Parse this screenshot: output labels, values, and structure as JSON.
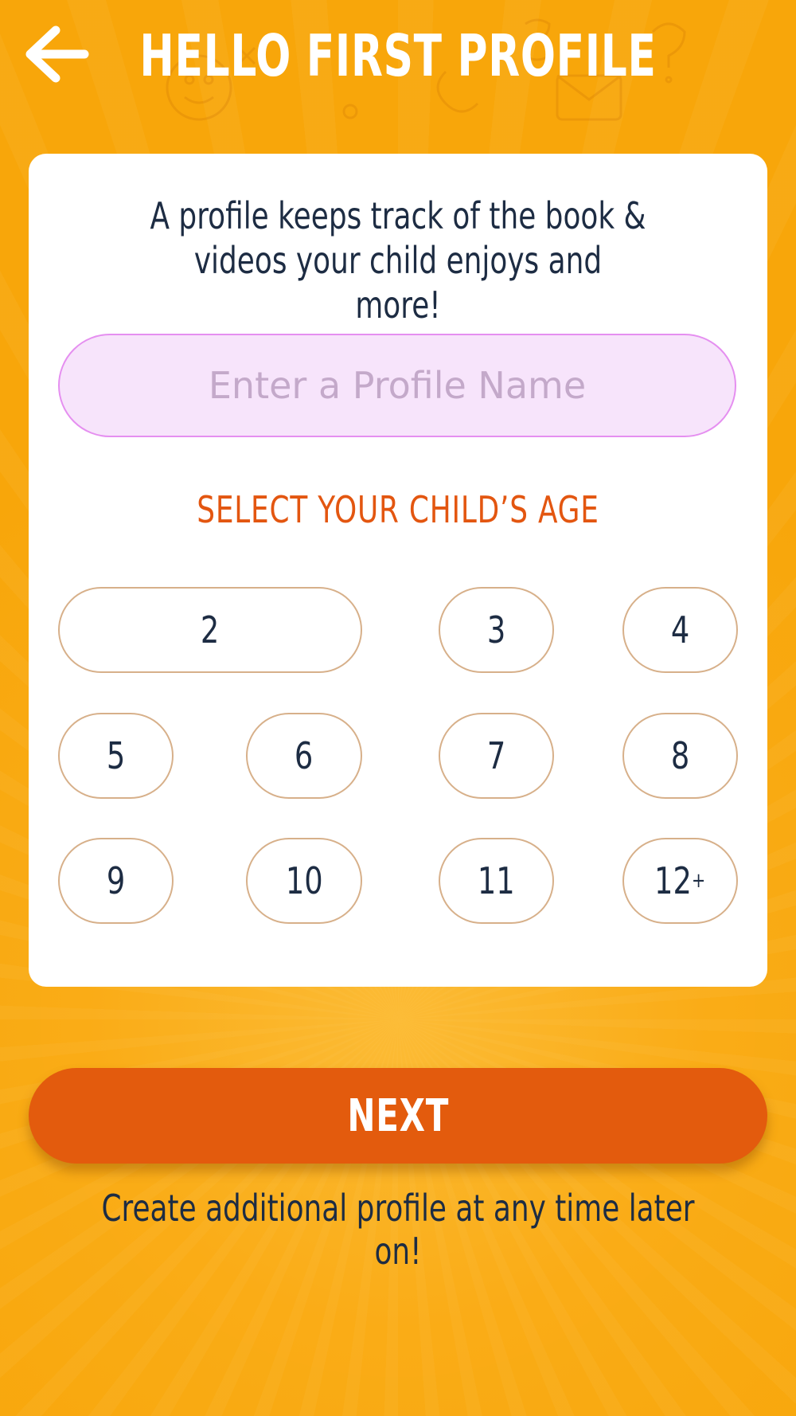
{
  "header": {
    "title": "HELLO FIRST PROFILE",
    "back_icon": "arrow-left-icon"
  },
  "card": {
    "intro": "A profile keeps track of the book & videos your child enjoys and more!",
    "name_input": {
      "value": "",
      "placeholder": "Enter a Profile Name"
    },
    "age_label": "SELECT YOUR CHILD’S AGE",
    "ages": [
      "2",
      "3",
      "4",
      "5",
      "6",
      "7",
      "8",
      "9",
      "10",
      "11",
      "12"
    ],
    "age_plus_suffix": "+"
  },
  "next_button": {
    "label": "NEXT"
  },
  "footer": {
    "note": "Create additional profile at any time later on!"
  },
  "colors": {
    "background": "#f8a60a",
    "card": "#ffffff",
    "accent": "#e35b0d",
    "input_fill": "#f7e4fb",
    "input_border": "#e58ff0",
    "age_border": "#d7b08a",
    "text": "#1d2c43"
  }
}
